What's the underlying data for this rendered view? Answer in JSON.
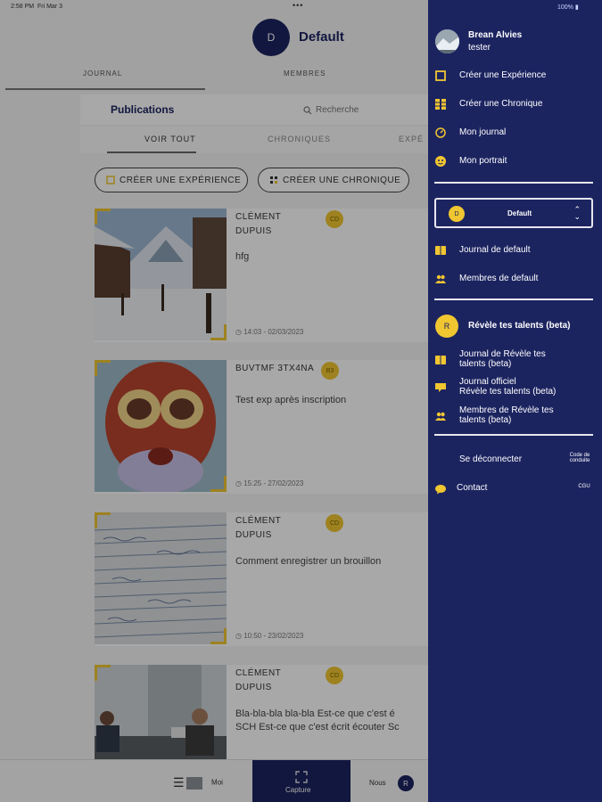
{
  "status": {
    "time": "2:58 PM",
    "date": "Fri Mar 3",
    "battery": "100%"
  },
  "header": {
    "avatar": "D",
    "title": "Default"
  },
  "tabs": [
    {
      "label": "JOURNAL"
    },
    {
      "label": "MEMBRES"
    }
  ],
  "publications": {
    "title": "Publications",
    "search_placeholder": "Recherche"
  },
  "filters": [
    {
      "label": "VOIR TOUT"
    },
    {
      "label": "CHRONIQUES"
    },
    {
      "label": "EXPÉ"
    }
  ],
  "actions": {
    "create_experience": "CRÉER UNE EXPÉRIENCE",
    "create_chronicle": "CRÉER UNE CHRONIQUE"
  },
  "posts": [
    {
      "author": "CLÉMENT DUPUIS",
      "badge": "CD",
      "text": "hfg",
      "date": "14:03 - 02/03/2023",
      "image": "mountain-chalet-photo"
    },
    {
      "author": "BUVTMF 3TX4NA",
      "badge": "B3",
      "text": "Test exp après inscription",
      "date": "15:25 - 27/02/2023",
      "image": "red-cartoon-face-drawing"
    },
    {
      "author": "CLÉMENT DUPUIS",
      "badge": "CD",
      "text": "Comment enregistrer un brouillon",
      "date": "10:50 - 23/02/2023",
      "image": "handwritten-notes-photo"
    },
    {
      "author": "CLÉMENT DUPUIS",
      "badge": "CD",
      "text": "Bla-bla-bla bla-bla Est-ce que c'est é",
      "text2": "SCH Est-ce que c'est écrit écouter Sc",
      "date": "",
      "image": "office-people-photo"
    }
  ],
  "bottom_nav": {
    "moi": "Moi",
    "capture": "Capture",
    "nous": "Nous",
    "nous_badge": "R"
  },
  "drawer": {
    "user": {
      "name": "Brean Alvies",
      "role": "tester"
    },
    "menu": [
      {
        "label": "Créer une Expérience",
        "icon": "experience-icon"
      },
      {
        "label": "Créer une Chronique",
        "icon": "chronicle-icon"
      },
      {
        "label": "Mon journal",
        "icon": "journal-icon"
      },
      {
        "label": "Mon portrait",
        "icon": "portrait-icon"
      }
    ],
    "group_select": {
      "avatar": "D",
      "value": "Default"
    },
    "default_links": [
      {
        "label": "Journal de default",
        "icon": "journal-book-icon"
      },
      {
        "label": "Membres de default",
        "icon": "members-icon"
      }
    ],
    "talent_group": {
      "avatar": "R",
      "name": "Révèle tes talents (beta)"
    },
    "talent_links": [
      {
        "line1": "Journal de Révèle tes",
        "line2": "talents (beta)",
        "icon": "journal-book-icon"
      },
      {
        "line1": "Journal officiel",
        "line2": "Révèle tes talents (beta)",
        "icon": "official-journal-icon"
      },
      {
        "line1": "Membres de Révèle tes",
        "line2": "talents (beta)",
        "icon": "members-icon"
      }
    ],
    "logout": "Se déconnecter",
    "code_conduite_1": "Code de",
    "code_conduite_2": "conduite",
    "contact": "Contact",
    "cgu": "CGU"
  }
}
